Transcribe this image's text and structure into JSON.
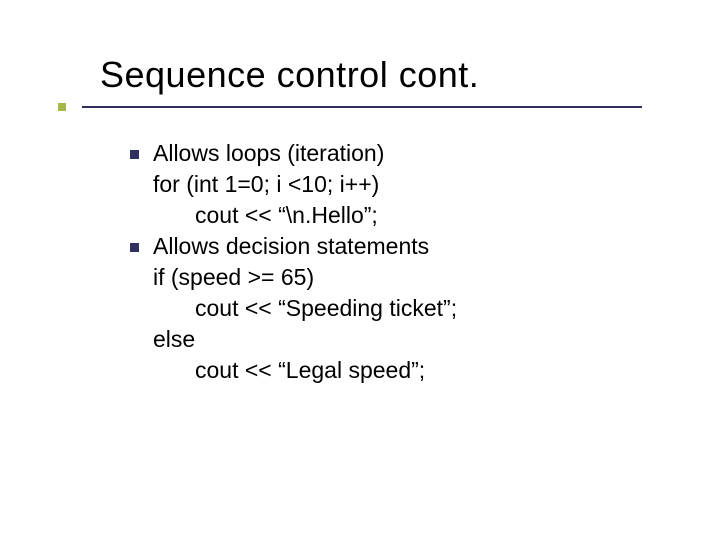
{
  "title": "Sequence control cont.",
  "items": [
    {
      "heading": "Allows loops (iteration)",
      "lines": [
        "for (int 1=0; i <10; i++)",
        "cout << “\\n.Hello”;"
      ],
      "indents": [
        0,
        1
      ]
    },
    {
      "heading": "Allows decision statements",
      "lines": [
        "if (speed >= 65)",
        "cout << “Speeding ticket”;",
        "else",
        "cout << “Legal speed”;"
      ],
      "indents": [
        0,
        1,
        0,
        1
      ]
    }
  ]
}
